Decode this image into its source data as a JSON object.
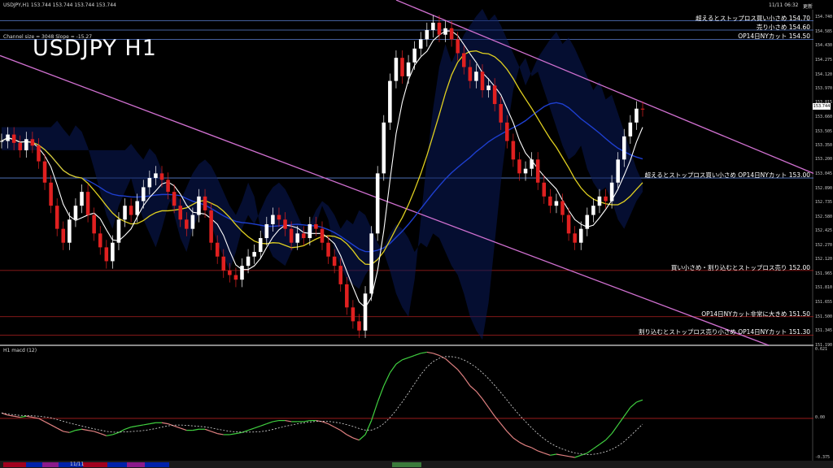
{
  "header": {
    "symbol_info": "USDJPY,H1  153.744 153.744 153.744 153.744",
    "datetime": "11/11 06:32",
    "status": "更新",
    "indicator_info": "Channel size = 3048 Slope = -15.27",
    "big_title": "USDJPY H1",
    "macd_label": "H1  macd (12)"
  },
  "levels": [
    {
      "price": 154.7,
      "text": "超えるとストップロス買い小さめ 154.70"
    },
    {
      "price": 154.6,
      "text": "売り小さめ 154.60"
    },
    {
      "price": 154.5,
      "text": "OP14日NYカット 154.50"
    },
    {
      "price": 153.0,
      "text": "超えるとストップロス買い小さめ  OP14日NYカット 153.00"
    },
    {
      "price": 152.0,
      "text": "買い小さめ・割り込むとストップロス売り 152.00"
    },
    {
      "price": 151.5,
      "text": "OP14日NYカット非常に大きめ 151.50"
    },
    {
      "price": 151.3,
      "text": "割り込むとストップロス売り小さめ  OP14日NYカット 151.30"
    }
  ],
  "price_axis": [
    "154.740",
    "154.585",
    "154.430",
    "154.275",
    "154.120",
    "153.970",
    "153.815",
    "153.660",
    "153.505",
    "153.350",
    "153.200",
    "153.045",
    "152.890",
    "152.735",
    "152.580",
    "152.425",
    "152.270",
    "152.120",
    "151.965",
    "151.810",
    "151.655",
    "151.500",
    "151.345",
    "151.190"
  ],
  "current_price": "153.744",
  "macd_axis": [
    "0.621",
    "0.00",
    "-0.375"
  ],
  "bottom_date": "11/11",
  "chart_data": {
    "type": "line",
    "ylim": [
      151.19,
      154.82
    ],
    "close": [
      153.4,
      153.47,
      153.38,
      153.3,
      153.42,
      153.35,
      153.18,
      152.95,
      152.7,
      152.45,
      152.3,
      152.55,
      152.7,
      152.85,
      152.6,
      152.4,
      152.25,
      152.1,
      152.3,
      152.55,
      152.7,
      152.6,
      152.75,
      152.9,
      153.0,
      153.05,
      152.98,
      152.85,
      152.7,
      152.55,
      152.45,
      152.6,
      152.8,
      152.65,
      152.3,
      152.15,
      152.0,
      151.95,
      151.9,
      152.05,
      152.15,
      152.2,
      152.35,
      152.5,
      152.6,
      152.55,
      152.45,
      152.3,
      152.4,
      152.35,
      152.5,
      152.45,
      152.3,
      152.15,
      152.05,
      151.85,
      151.6,
      151.45,
      151.35,
      151.75,
      152.4,
      153.05,
      153.6,
      154.05,
      154.3,
      154.1,
      154.25,
      154.4,
      154.5,
      154.6,
      154.68,
      154.55,
      154.62,
      154.5,
      154.35,
      154.2,
      154.05,
      154.15,
      153.95,
      154.0,
      153.8,
      153.6,
      153.4,
      153.2,
      153.05,
      153.1,
      153.2,
      152.95,
      152.8,
      152.7,
      152.75,
      152.6,
      152.4,
      152.3,
      152.45,
      152.6,
      152.7,
      152.8,
      152.75,
      152.95,
      153.2,
      153.45,
      153.6,
      153.75,
      153.744
    ],
    "macd": [
      0.05,
      0.03,
      0.02,
      0.01,
      0.02,
      0.01,
      0.0,
      -0.03,
      -0.06,
      -0.09,
      -0.12,
      -0.13,
      -0.11,
      -0.1,
      -0.11,
      -0.12,
      -0.14,
      -0.16,
      -0.15,
      -0.13,
      -0.1,
      -0.08,
      -0.07,
      -0.06,
      -0.05,
      -0.04,
      -0.04,
      -0.05,
      -0.07,
      -0.09,
      -0.11,
      -0.11,
      -0.1,
      -0.1,
      -0.12,
      -0.14,
      -0.15,
      -0.15,
      -0.14,
      -0.13,
      -0.11,
      -0.09,
      -0.07,
      -0.05,
      -0.03,
      -0.02,
      -0.02,
      -0.03,
      -0.03,
      -0.03,
      -0.02,
      -0.02,
      -0.03,
      -0.05,
      -0.08,
      -0.11,
      -0.15,
      -0.18,
      -0.2,
      -0.15,
      -0.02,
      0.15,
      0.3,
      0.42,
      0.5,
      0.54,
      0.56,
      0.58,
      0.6,
      0.61,
      0.6,
      0.58,
      0.55,
      0.5,
      0.45,
      0.38,
      0.3,
      0.25,
      0.18,
      0.1,
      0.02,
      -0.05,
      -0.12,
      -0.18,
      -0.22,
      -0.25,
      -0.27,
      -0.3,
      -0.32,
      -0.34,
      -0.33,
      -0.34,
      -0.35,
      -0.36,
      -0.34,
      -0.32,
      -0.28,
      -0.24,
      -0.2,
      -0.14,
      -0.06,
      0.02,
      0.1,
      0.15,
      0.17
    ]
  }
}
